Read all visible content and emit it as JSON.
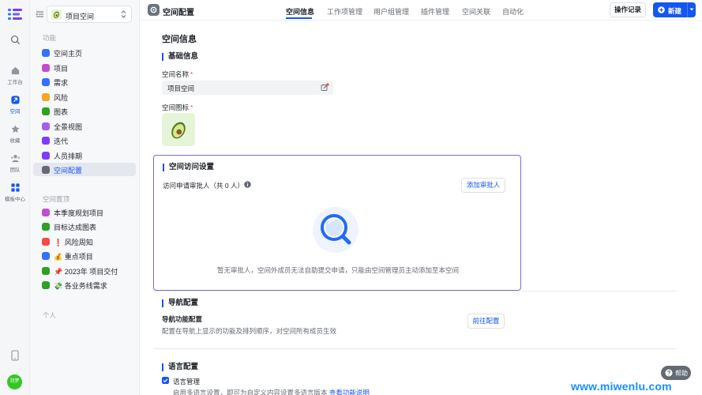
{
  "rail": {
    "items": [
      {
        "label": "",
        "icon": "search-icon"
      },
      {
        "label": "工作台",
        "icon": "home-icon"
      },
      {
        "label": "空间",
        "icon": "space-icon"
      },
      {
        "label": "收藏",
        "icon": "star-icon"
      },
      {
        "label": "团队",
        "icon": "team-icon"
      },
      {
        "label": "模板中心",
        "icon": "template-icon"
      }
    ],
    "user_avatar": "刘梦"
  },
  "sidebar": {
    "space_name": "项目空间",
    "group_function": "功能",
    "items": [
      {
        "label": "空间主页",
        "color": "#3370ff"
      },
      {
        "label": "项目",
        "color": "#c44bd0"
      },
      {
        "label": "需求",
        "color": "#3370ff"
      },
      {
        "label": "风险",
        "color": "#f5a623"
      },
      {
        "label": "图表",
        "color": "#2ea121"
      },
      {
        "label": "全景视图",
        "color": "#a55fe8"
      },
      {
        "label": "迭代",
        "color": "#7f3bf5"
      },
      {
        "label": "人员排期",
        "color": "#7f3bf5"
      },
      {
        "label": "空间配置",
        "color": "#646a73"
      }
    ],
    "group_pinned": "空间置顶",
    "pinned": [
      {
        "label": "本季度规划项目",
        "color": "#c44bd0"
      },
      {
        "label": "目标达成图表",
        "color": "#2ea121"
      },
      {
        "label": "❗ 风险周知",
        "color": "#f54a45"
      },
      {
        "label": "💰 重点项目",
        "color": "#3370ff"
      },
      {
        "label": "📌 2023年 项目交付",
        "color": "#2ea121"
      },
      {
        "label": "💸 各业务线需求",
        "color": "#2ea121"
      }
    ],
    "group_personal": "个人"
  },
  "topbar": {
    "title": "空间配置",
    "tabs": [
      "空间信息",
      "工作项管理",
      "用户组管理",
      "插件管理",
      "空间关联",
      "自动化"
    ],
    "active_tab": "空间信息",
    "log_label": "操作记录",
    "new_label": "新建"
  },
  "main": {
    "heading": "空间信息",
    "basic_title": "基础信息",
    "name_label": "空间名称",
    "name_value": "项目空间",
    "icon_label": "空间图标",
    "required_mark": "*",
    "access_title": "空间访问设置",
    "approver_label": "访问申请审批人（共 0 人）",
    "add_approver": "添加审批人",
    "empty_text": "暂无审批人，空间外成员无法自助提交申请，只能由空间管理员主动添加至本空间",
    "nav_title": "导航配置",
    "nav_cfg_title": "导航功能配置",
    "nav_cfg_desc": "配置在导航上显示的功能及排列顺序，对空间所有成员生效",
    "nav_goto": "前往配置",
    "lang_title": "语言配置",
    "lang_label": "语言管理",
    "lang_desc": "启用多语言设置，即可为自定义内容设置多语言版本",
    "lang_link": "查看功能说明"
  },
  "help": "帮助",
  "watermark": "www.miwenlu.com",
  "colors": {
    "accent": "#1456f0",
    "highlight_border": "#7a6ccf"
  }
}
